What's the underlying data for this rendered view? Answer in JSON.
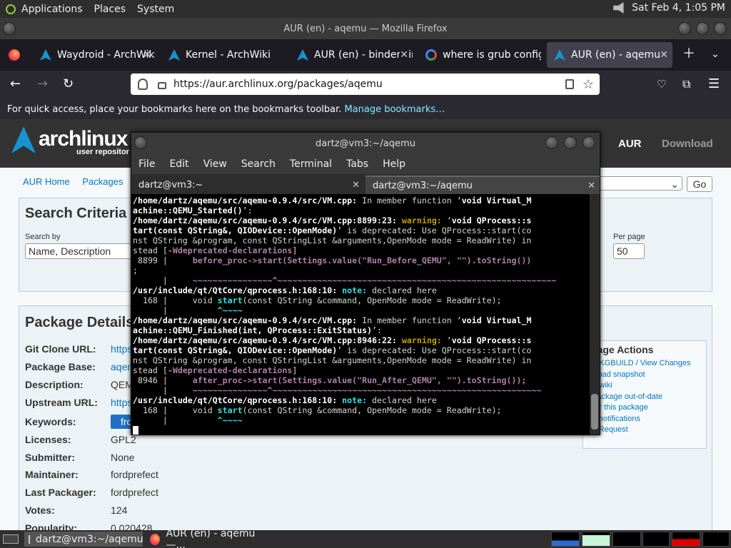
{
  "panel": {
    "menus": [
      "Applications",
      "Places",
      "System"
    ],
    "datetime": "Sat Feb  4,  1:05 PM"
  },
  "firefox": {
    "window_title": "AUR (en) - aqemu — Mozilla Firefox",
    "tabs": [
      {
        "label": "Waydroid - ArchWiki"
      },
      {
        "label": "Kernel - ArchWiki"
      },
      {
        "label": "AUR (en) - binder_lin"
      },
      {
        "label": "where is grub config"
      },
      {
        "label": "AUR (en) - aqemu"
      }
    ],
    "url": "https://aur.archlinux.org/packages/aqemu",
    "bookmarks_text": "For quick access, place your bookmarks here on the bookmarks toolbar.",
    "bookmarks_link": "Manage bookmarks…"
  },
  "aur_page": {
    "logo": "archlinux",
    "logo_sub": "user repositor",
    "nav_aur": "AUR",
    "nav_download": "Download",
    "subnav": [
      "AUR Home",
      "Packages",
      "Re"
    ],
    "go_button": "Go",
    "search_title": "Search Criteria",
    "search_by_label": "Search by",
    "search_by_value": "Name, Description",
    "per_page_label": "Per page",
    "per_page_value": "50",
    "details_title": "Package Details",
    "details": [
      {
        "label": "Git Clone URL:",
        "value": "https"
      },
      {
        "label": "Package Base:",
        "value": "aqen"
      },
      {
        "label": "Description:",
        "value": "QEM"
      },
      {
        "label": "Upstream URL:",
        "value": "https"
      },
      {
        "label": "Keywords:",
        "value": "fro"
      },
      {
        "label": "Licenses:",
        "value": "GPL2"
      },
      {
        "label": "Submitter:",
        "value": "None"
      },
      {
        "label": "Maintainer:",
        "value": "fordprefect"
      },
      {
        "label": "Last Packager:",
        "value": "fordprefect"
      },
      {
        "label": "Votes:",
        "value": "124"
      },
      {
        "label": "Popularity:",
        "value": "0.020428"
      }
    ],
    "actions_title": "ckage Actions",
    "actions": [
      "w PKGBUILD / View Changes",
      "wnload snapshot",
      "rch wiki",
      "g package out-of-date",
      "e for this package",
      "ble notifications",
      "mit Request"
    ]
  },
  "terminal": {
    "title": "dartz@vm3:~/aqemu",
    "menus": [
      "File",
      "Edit",
      "View",
      "Search",
      "Terminal",
      "Tabs",
      "Help"
    ],
    "tabs": [
      "dartz@vm3:~",
      "dartz@vm3:~/aqemu"
    ],
    "lines": [
      {
        "t": "/home/dartz/aqemu/src/aqemu-0.9.4/src/VM.cpp:",
        "r": " In member function ‘",
        "b2": "void Virtual_M"
      },
      {
        "t": "achine::QEMU_Started()",
        "r": "’:"
      },
      {
        "t": "/home/dartz/aqemu/src/aqemu-0.9.4/src/VM.cpp:8899:23:",
        "w": " warning:",
        "r": " ‘",
        "b2": "void QProcess::s"
      },
      {
        "t": "tart(const QString&, QIODevice::OpenMode)",
        "r": "’ is deprecated: Use QProcess::start(co"
      },
      {
        "r": "nst QString &program, const QStringList &arguments,OpenMode mode = ReadWrite) in"
      },
      {
        "r": "stead [",
        "m": "-Wdeprecated-declarations",
        "r2": "]"
      },
      {
        "r": " 8899 |     ",
        "m": "before_proc->start(Settings.value(\"Run_Before_QEMU\", \"\").toString())",
        "r2": ""
      },
      {
        "r": ";"
      },
      {
        "r": "      |     ",
        "m": "~~~~~~~~~~~~~~~~^~~~~~~~~~~~~~~~~~~~~~~~~~~~~~~~~~~~~~~~~~~~~~~~~~~~~~~~~"
      },
      {
        "t": "/usr/include/qt/QtCore/qprocess.h:168:10:",
        "c": " note:",
        "r": " declared here"
      },
      {
        "r": "  168 |     void ",
        "c": "start",
        "r2": "(const QString &command, OpenMode mode = ReadWrite);"
      },
      {
        "r": "      |          ",
        "c": "^~~~~"
      },
      {
        "t": "/home/dartz/aqemu/src/aqemu-0.9.4/src/VM.cpp:",
        "r": " In member function ‘",
        "b2": "void Virtual_M"
      },
      {
        "t": "achine::QEMU_Finished(int, QProcess::ExitStatus)",
        "r": "’:"
      },
      {
        "t": "/home/dartz/aqemu/src/aqemu-0.9.4/src/VM.cpp:8946:22:",
        "w": " warning:",
        "r": " ‘",
        "b2": "void QProcess::s"
      },
      {
        "t": "tart(const QString&, QIODevice::OpenMode)",
        "r": "’ is deprecated: Use QProcess::start(co"
      },
      {
        "r": "nst QString &program, const QStringList &arguments,OpenMode mode = ReadWrite) in"
      },
      {
        "r": "stead [",
        "m": "-Wdeprecated-declarations",
        "r2": "]"
      },
      {
        "r": " 8946 |     ",
        "m": "after_proc->start(Settings.value(\"Run_After_QEMU\", \"\").toString());"
      },
      {
        "r": "      |     ",
        "m": "~~~~~~~~~~~~~~~^~~~~~~~~~~~~~~~~~~~~~~~~~~~~~~~~~~~~~~~~~~~~~~~~~~~~~~"
      },
      {
        "t": "/usr/include/qt/QtCore/qprocess.h:168:10:",
        "c": " note:",
        "r": " declared here"
      },
      {
        "r": "  168 |     void ",
        "c": "start",
        "r2": "(const QString &command, OpenMode mode = ReadWrite);"
      },
      {
        "r": "      |          ",
        "c": "^~~~~"
      }
    ]
  },
  "taskbar": {
    "tasks": [
      "dartz@vm3:~/aqemu",
      "AUR (en) - aqemu —..."
    ]
  }
}
